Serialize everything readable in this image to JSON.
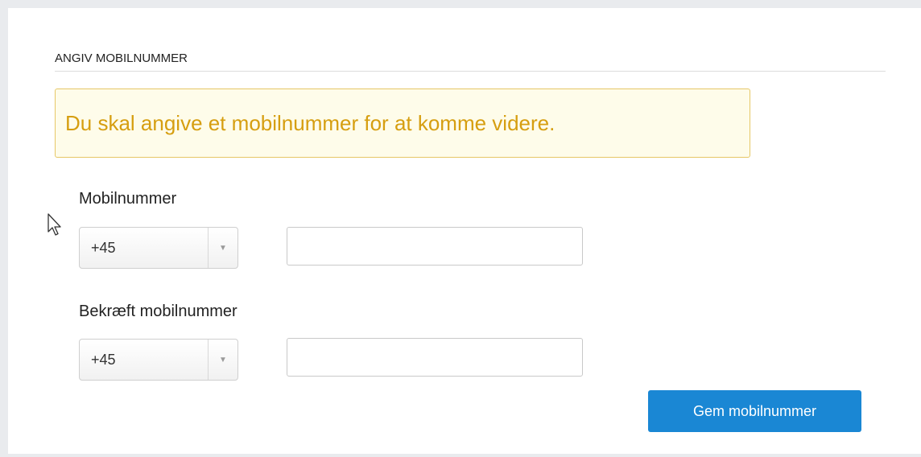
{
  "section": {
    "heading": "ANGIV MOBILNUMMER"
  },
  "alert": {
    "message": "Du skal angive et mobilnummer for at komme videre.",
    "colors": {
      "background": "#fefcea",
      "border": "#e6c766",
      "text": "#d69e10"
    }
  },
  "form": {
    "mobile": {
      "label": "Mobilnummer",
      "country_code": "+45",
      "value": ""
    },
    "confirm_mobile": {
      "label": "Bekræft mobilnummer",
      "country_code": "+45",
      "value": ""
    },
    "save_label": "Gem mobilnummer"
  },
  "icons": {
    "dropdown": "chevron-down-icon",
    "cursor": "mouse-pointer-icon"
  },
  "colors": {
    "accent": "#1a87d4"
  }
}
